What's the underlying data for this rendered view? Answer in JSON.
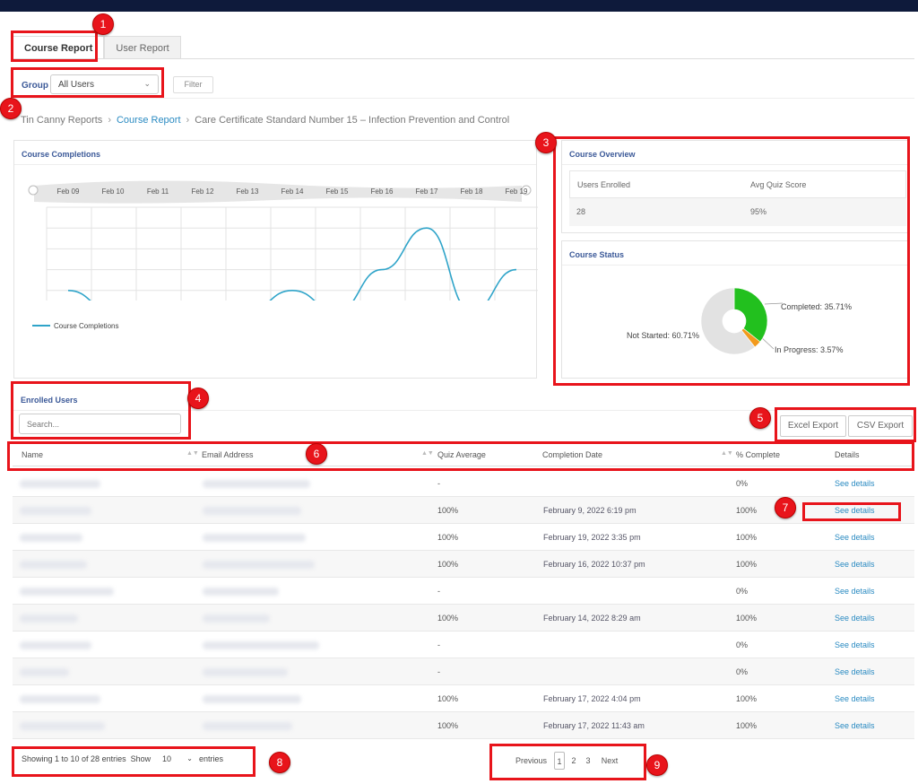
{
  "tabs": [
    {
      "label": "Course Report",
      "active": true
    },
    {
      "label": "User Report",
      "active": false
    }
  ],
  "group": {
    "label": "Group",
    "selected": "All Users",
    "filter_label": "Filter"
  },
  "breadcrumb": [
    "Tin Canny Reports",
    "Course Report",
    "Care Certificate Standard Number 15 – Infection Prevention and Control"
  ],
  "completions": {
    "title": "Course Completions",
    "legend": "Course Completions"
  },
  "chart_data": {
    "type": "line",
    "x": [
      "Feb 09",
      "Feb 10",
      "Feb 11",
      "Feb 12",
      "Feb 13",
      "Feb 14",
      "Feb 15",
      "Feb 16",
      "Feb 17",
      "Feb 18",
      "Feb 19"
    ],
    "series": [
      {
        "name": "Course Completions",
        "values": [
          1,
          0,
          0,
          0,
          0,
          1,
          0,
          2,
          4,
          0,
          2
        ]
      }
    ],
    "yticks": [
      "5",
      "4",
      "3",
      "2",
      "1"
    ],
    "ylim": [
      0,
      5
    ],
    "grid": true,
    "legend_position": "bottom-left",
    "color": "#2fa4c9"
  },
  "overview": {
    "title": "Course Overview",
    "headers": [
      "Users Enrolled",
      "Avg Quiz Score"
    ],
    "values": [
      "28",
      "95%"
    ]
  },
  "status": {
    "title": "Course Status",
    "slices": [
      {
        "label": "Completed: 35.71%",
        "value": 35.71,
        "color": "#22c01e"
      },
      {
        "label": "In Progress: 3.57%",
        "value": 3.57,
        "color": "#f29a1d"
      },
      {
        "label": "Not Started: 60.71%",
        "value": 60.71,
        "color": "#e2e2e2"
      }
    ]
  },
  "enrolled": {
    "title": "Enrolled Users",
    "search_placeholder": "Search...",
    "excel_label": "Excel Export",
    "csv_label": "CSV Export"
  },
  "table": {
    "headers": [
      "Name",
      "Email Address",
      "Quiz Average",
      "Completion Date",
      "% Complete",
      "Details"
    ],
    "rows": [
      {
        "quiz": "-",
        "date": "",
        "pct": "0%",
        "details": "See details"
      },
      {
        "quiz": "100%",
        "date": "February 9, 2022 6:19 pm",
        "pct": "100%",
        "details": "See details"
      },
      {
        "quiz": "100%",
        "date": "February 19, 2022 3:35 pm",
        "pct": "100%",
        "details": "See details"
      },
      {
        "quiz": "100%",
        "date": "February 16, 2022 10:37 pm",
        "pct": "100%",
        "details": "See details"
      },
      {
        "quiz": "-",
        "date": "",
        "pct": "0%",
        "details": "See details"
      },
      {
        "quiz": "100%",
        "date": "February 14, 2022 8:29 am",
        "pct": "100%",
        "details": "See details"
      },
      {
        "quiz": "-",
        "date": "",
        "pct": "0%",
        "details": "See details"
      },
      {
        "quiz": "-",
        "date": "",
        "pct": "0%",
        "details": "See details"
      },
      {
        "quiz": "100%",
        "date": "February 17, 2022 4:04 pm",
        "pct": "100%",
        "details": "See details"
      },
      {
        "quiz": "100%",
        "date": "February 17, 2022 11:43 am",
        "pct": "100%",
        "details": "See details"
      }
    ]
  },
  "footer": {
    "info": "Showing 1 to 10 of 28 entries",
    "show_label": "Show",
    "show_value": "10",
    "entries_label": "entries",
    "previous": "Previous",
    "pages": [
      "1",
      "2",
      "3"
    ],
    "next": "Next"
  },
  "annotations": [
    "1",
    "2",
    "3",
    "4",
    "5",
    "6",
    "7",
    "8",
    "9"
  ],
  "colors": {
    "accent_link": "#2b8bc2",
    "title_blue": "#3b5998",
    "annotation_red": "#e8141b",
    "topbar": "#0e1a3b"
  }
}
